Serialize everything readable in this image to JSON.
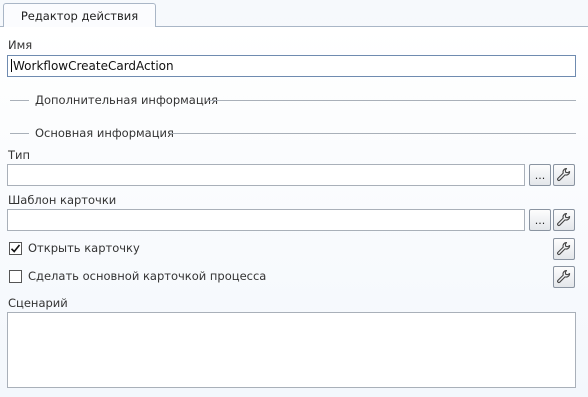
{
  "tab": {
    "label": "Редактор действия"
  },
  "name": {
    "label": "Имя",
    "value": "WorkflowCreateCardAction"
  },
  "groups": {
    "additional": "Дополнительная информация",
    "main": "Основная информация"
  },
  "type": {
    "label": "Тип",
    "value": "",
    "browse_label": "..."
  },
  "template": {
    "label": "Шаблон карточки",
    "value": "",
    "browse_label": "..."
  },
  "open_card": {
    "label": "Открыть карточку",
    "checked": true
  },
  "make_main": {
    "label": "Сделать основной карточкой процесса",
    "checked": false
  },
  "scenario": {
    "label": "Сценарий",
    "value": ""
  },
  "icons": {
    "settings": "wrench-icon",
    "check": "checkmark-icon"
  }
}
